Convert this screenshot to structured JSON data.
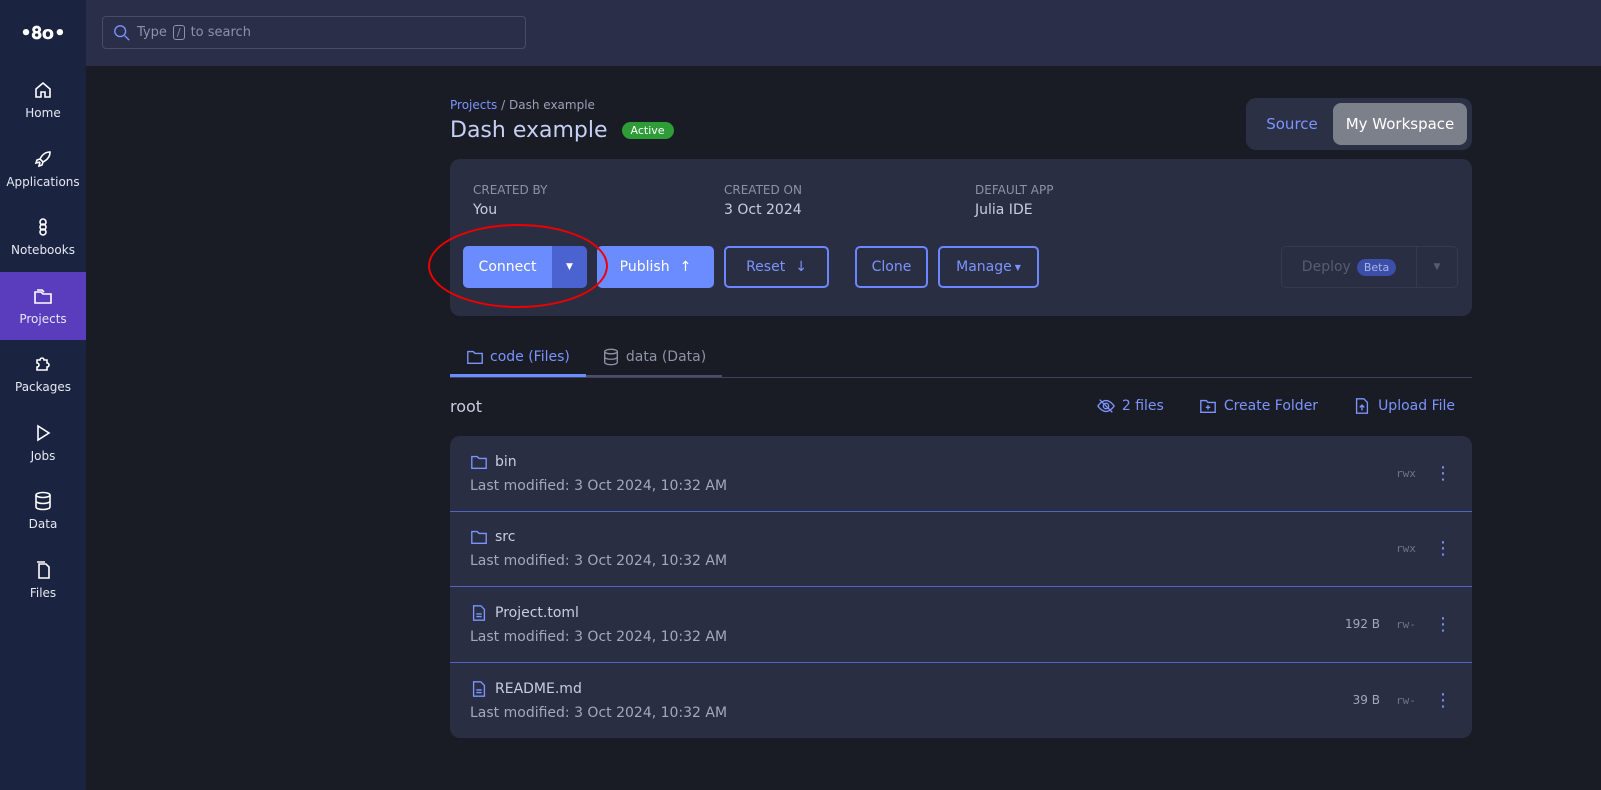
{
  "sidebar": {
    "items": [
      {
        "label": "Home",
        "icon": "home-icon"
      },
      {
        "label": "Applications",
        "icon": "rocket-icon"
      },
      {
        "label": "Notebooks",
        "icon": "notebook-icon"
      },
      {
        "label": "Projects",
        "icon": "folders-icon",
        "active": true
      },
      {
        "label": "Packages",
        "icon": "puzzle-icon"
      },
      {
        "label": "Jobs",
        "icon": "play-icon"
      },
      {
        "label": "Data",
        "icon": "database-icon"
      },
      {
        "label": "Files",
        "icon": "files-icon"
      }
    ]
  },
  "search": {
    "pre": "Type",
    "key": "/",
    "post": "to search"
  },
  "breadcrumb": {
    "root": "Projects",
    "sep": "/",
    "current": "Dash example"
  },
  "project": {
    "title": "Dash example",
    "status": "Active"
  },
  "view_toggle": {
    "source": "Source",
    "workspace": "My Workspace"
  },
  "meta": {
    "created_by_label": "CREATED BY",
    "created_by": "You",
    "created_on_label": "CREATED ON",
    "created_on": "3 Oct 2024",
    "default_app_label": "DEFAULT APP",
    "default_app": "Julia IDE"
  },
  "actions": {
    "connect": "Connect",
    "publish": "Publish",
    "reset": "Reset",
    "clone": "Clone",
    "manage": "Manage",
    "deploy": "Deploy",
    "beta": "Beta"
  },
  "tabs": [
    {
      "label": "code (Files)",
      "active": true
    },
    {
      "label": "data (Data)"
    }
  ],
  "files": {
    "path": "root",
    "count": "2 files",
    "create_folder": "Create Folder",
    "upload_file": "Upload File",
    "rows": [
      {
        "name": "bin",
        "type": "folder",
        "modified": "Last modified: 3 Oct 2024, 10:32 AM",
        "size": "",
        "perm": "rwx"
      },
      {
        "name": "src",
        "type": "folder",
        "modified": "Last modified: 3 Oct 2024, 10:32 AM",
        "size": "",
        "perm": "rwx"
      },
      {
        "name": "Project.toml",
        "type": "file",
        "modified": "Last modified: 3 Oct 2024, 10:32 AM",
        "size": "192 B",
        "perm": "rw-"
      },
      {
        "name": "README.md",
        "type": "file",
        "modified": "Last modified: 3 Oct 2024, 10:32 AM",
        "size": "39 B",
        "perm": "rw-"
      }
    ]
  },
  "colors": {
    "accent": "#6b8cff",
    "active_nav": "#5a3dbd",
    "status_active": "#2e9d38"
  }
}
